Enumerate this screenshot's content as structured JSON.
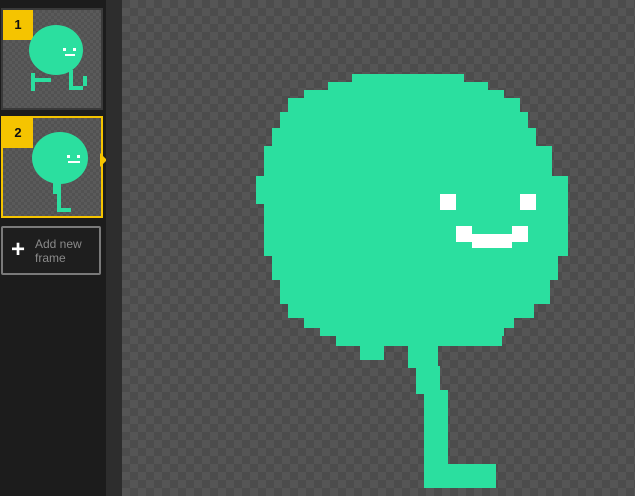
{
  "frames": [
    {
      "number": "1",
      "selected": false
    },
    {
      "number": "2",
      "selected": true
    }
  ],
  "add_frame": {
    "label": "Add new frame",
    "icon": "plus-icon"
  },
  "colors": {
    "accent": "#f5c400",
    "sprite": "#2bdf9f",
    "face": "#ffffff",
    "panel": "#1c1c1c"
  }
}
